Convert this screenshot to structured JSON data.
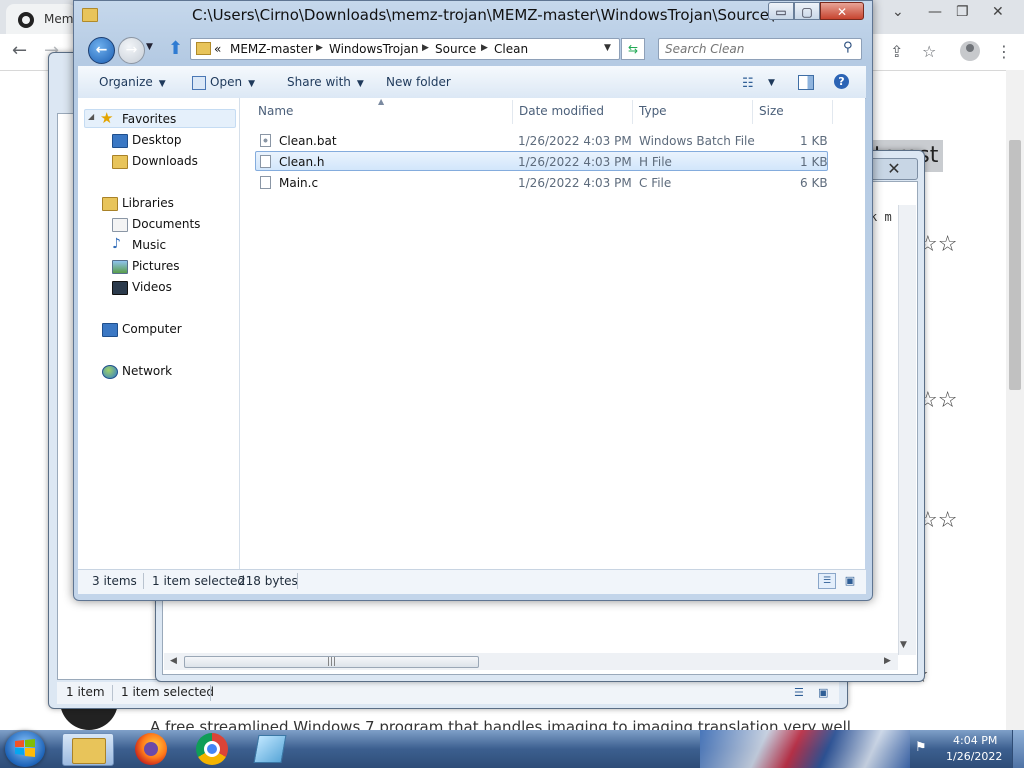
{
  "browser": {
    "tab_title": "Mem",
    "nav": {
      "back": "←",
      "forward": "→"
    },
    "controls": {
      "chevron": "⌄",
      "minimize": "—",
      "restore": "❐",
      "close": "✕"
    },
    "toolbar_icons": {
      "share": "⇪",
      "bookmark": "☆",
      "menu": "⋮"
    },
    "heading_fragment": "terest",
    "caption": "A free streamlined Windows 7 program that handles imaging to imaging translation very well",
    "stars": "☆☆",
    "stars_full": "☆☆☆☆"
  },
  "bg_windows": {
    "code_fragment": "k m",
    "close": "✕",
    "status_items": "1 item",
    "status_selected": "1 item selected",
    "scroll": {
      "left": "◀",
      "right": "▶",
      "down": "▼",
      "thumb_grip": "|||"
    }
  },
  "explorer": {
    "title": "C:\\Users\\Cirno\\Downloads\\memz-trojan\\MEMZ-master\\WindowsTrojan\\Source\\Clean",
    "caption_buttons": {
      "minimize": "▭",
      "maximize": "▢",
      "close": "✕"
    },
    "nav": {
      "back": "←",
      "forward": "→",
      "recent": "▼",
      "up": "⬆"
    },
    "address": {
      "overflow": "«",
      "crumbs": [
        "MEMZ-master",
        "WindowsTrojan",
        "Source",
        "Clean"
      ],
      "separator": "▶",
      "dropdown": "▼",
      "refresh": "⇆"
    },
    "search": {
      "placeholder": "Search Clean",
      "icon": "⚲"
    },
    "commands": {
      "organize": "Organize",
      "open": "Open",
      "share_with": "Share with",
      "new_folder": "New folder",
      "caret": "▼",
      "views_icon": "☷",
      "help": "?"
    },
    "nav_pane": {
      "favorites": "Favorites",
      "desktop": "Desktop",
      "downloads": "Downloads",
      "libraries": "Libraries",
      "documents": "Documents",
      "music": "Music",
      "pictures": "Pictures",
      "videos": "Videos",
      "computer": "Computer",
      "network": "Network",
      "collapse": "◢",
      "star": "★"
    },
    "columns": {
      "name": "Name",
      "date_modified": "Date modified",
      "type": "Type",
      "size": "Size",
      "sort": "▲"
    },
    "files": [
      {
        "name": "Clean.bat",
        "date": "1/26/2022 4:03 PM",
        "type": "Windows Batch File",
        "size": "1 KB"
      },
      {
        "name": "Clean.h",
        "date": "1/26/2022 4:03 PM",
        "type": "H File",
        "size": "1 KB"
      },
      {
        "name": "Main.c",
        "date": "1/26/2022 4:03 PM",
        "type": "C File",
        "size": "6 KB"
      }
    ],
    "status": {
      "items": "3 items",
      "selected": "1 item selected",
      "bytes": "218 bytes",
      "details_view": "☰",
      "icons_view": "▣"
    }
  },
  "taskbar": {
    "time": "4:04 PM",
    "date": "1/26/2022",
    "tray_flag": "⚑"
  },
  "colors": {
    "taskbar": "#3c5f8f",
    "selection": "#d2e6fb",
    "link": "#1e395b"
  }
}
